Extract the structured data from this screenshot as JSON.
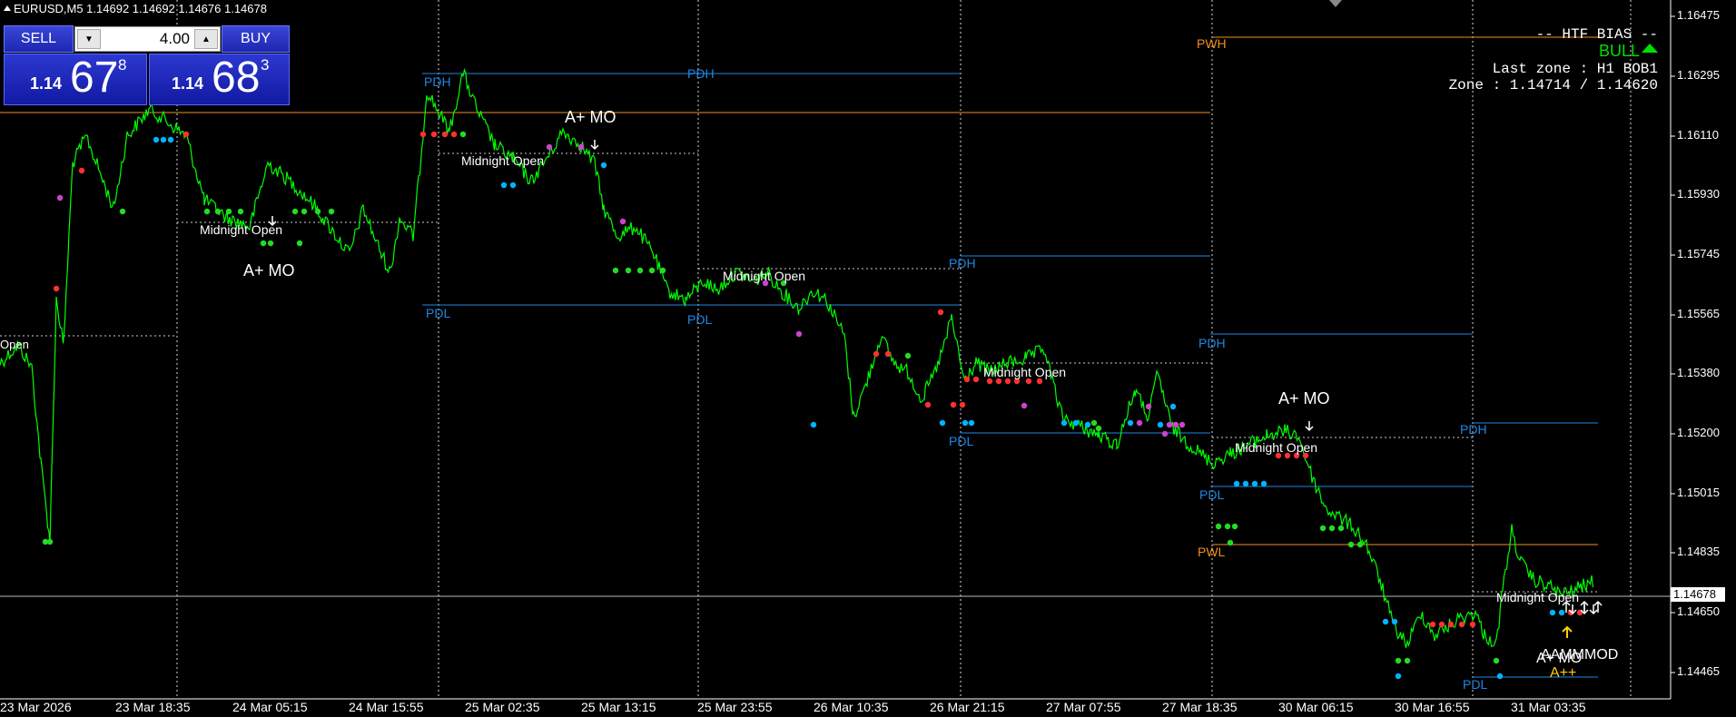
{
  "header": {
    "symbol_line": "EURUSD,M5  1.14692 1.14692 1.14676 1.14678"
  },
  "trade_panel": {
    "sell_label": "SELL",
    "buy_label": "BUY",
    "lot_value": "4.00",
    "sell_quote": {
      "prefix": "1.14",
      "big": "67",
      "super": "8"
    },
    "buy_quote": {
      "prefix": "1.14",
      "big": "68",
      "super": "3"
    }
  },
  "htf_bias": {
    "title": "-- HTF BIAS --",
    "bias": "BULL",
    "last_zone": "Last zone : H1 BOB1",
    "zone": "Zone : 1.14714 / 1.14620"
  },
  "price_axis": {
    "ticks": [
      "1.16475",
      "1.16295",
      "1.16110",
      "1.15930",
      "1.15745",
      "1.15565",
      "1.15380",
      "1.15200",
      "1.15015",
      "1.14835",
      "1.14650",
      "1.14465"
    ],
    "current": "1.14678"
  },
  "time_axis": {
    "labels": [
      "23 Mar 2026",
      "23 Mar 18:35",
      "24 Mar 05:15",
      "24 Mar 15:55",
      "25 Mar 02:35",
      "25 Mar 13:15",
      "25 Mar 23:55",
      "26 Mar 10:35",
      "26 Mar 21:15",
      "27 Mar 07:55",
      "27 Mar 18:35",
      "30 Mar 06:15",
      "30 Mar 16:55",
      "31 Mar 03:35"
    ]
  },
  "annotations": {
    "pdh": "PDH",
    "pdl": "PDL",
    "pwh": "PWH",
    "pwl": "PWL",
    "midnight_open": "Midnight Open",
    "open": "Open",
    "a_plus_mo": "A+ MO",
    "a_plus_plus": "A++",
    "stacked": "AAMMMOD"
  },
  "colors": {
    "background": "#000000",
    "price_line": "#00ff00",
    "pdh_pdl": "#1e88e5",
    "pwh_pwl": "#f0901e",
    "grid": "#ffffff",
    "bull": "#00e000",
    "dot_blue": "#00b4ff",
    "dot_red": "#ff3030",
    "dot_magenta": "#cc44cc",
    "dot_green": "#22dd22",
    "a_plus_plus": "#ffd000"
  }
}
